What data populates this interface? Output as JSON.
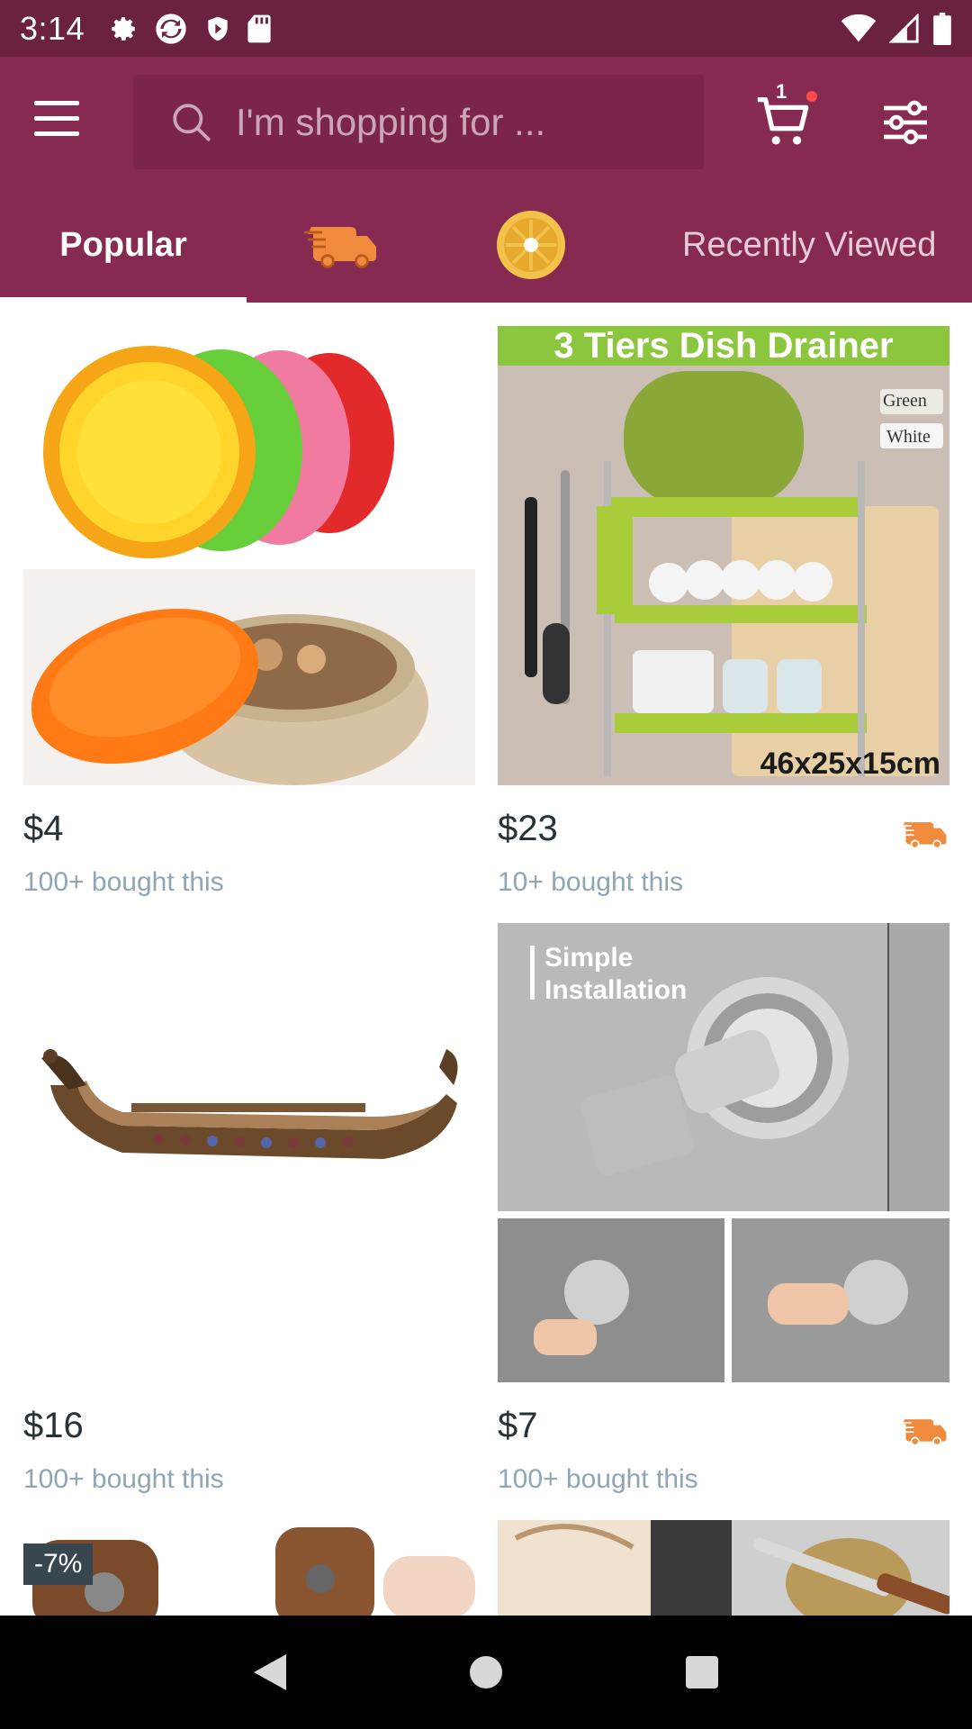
{
  "status_bar": {
    "time": "3:14"
  },
  "header": {
    "search_placeholder": "I'm shopping for ...",
    "cart_count": "1"
  },
  "tabs": {
    "popular": "Popular",
    "recently_viewed": "Recently Viewed"
  },
  "products": [
    {
      "price": "$4",
      "bought": "100+ bought this"
    },
    {
      "price": "$23",
      "bought": "10+ bought this",
      "image_title": "3 Tiers Dish Drainer",
      "color_green": "Green",
      "color_white": "White",
      "size": "46x25x15cm"
    },
    {
      "price": "$16",
      "bought": "100+ bought this"
    },
    {
      "price": "$7",
      "bought": "100+ bought this",
      "image_caption_1": "Simple",
      "image_caption_2": "Installation"
    }
  ],
  "discount_badge": "-7%",
  "colors": {
    "status_bar": "#6b2140",
    "app_bar": "#862a52",
    "search_bg": "#7a2549",
    "shipping": "#f08a3c"
  }
}
